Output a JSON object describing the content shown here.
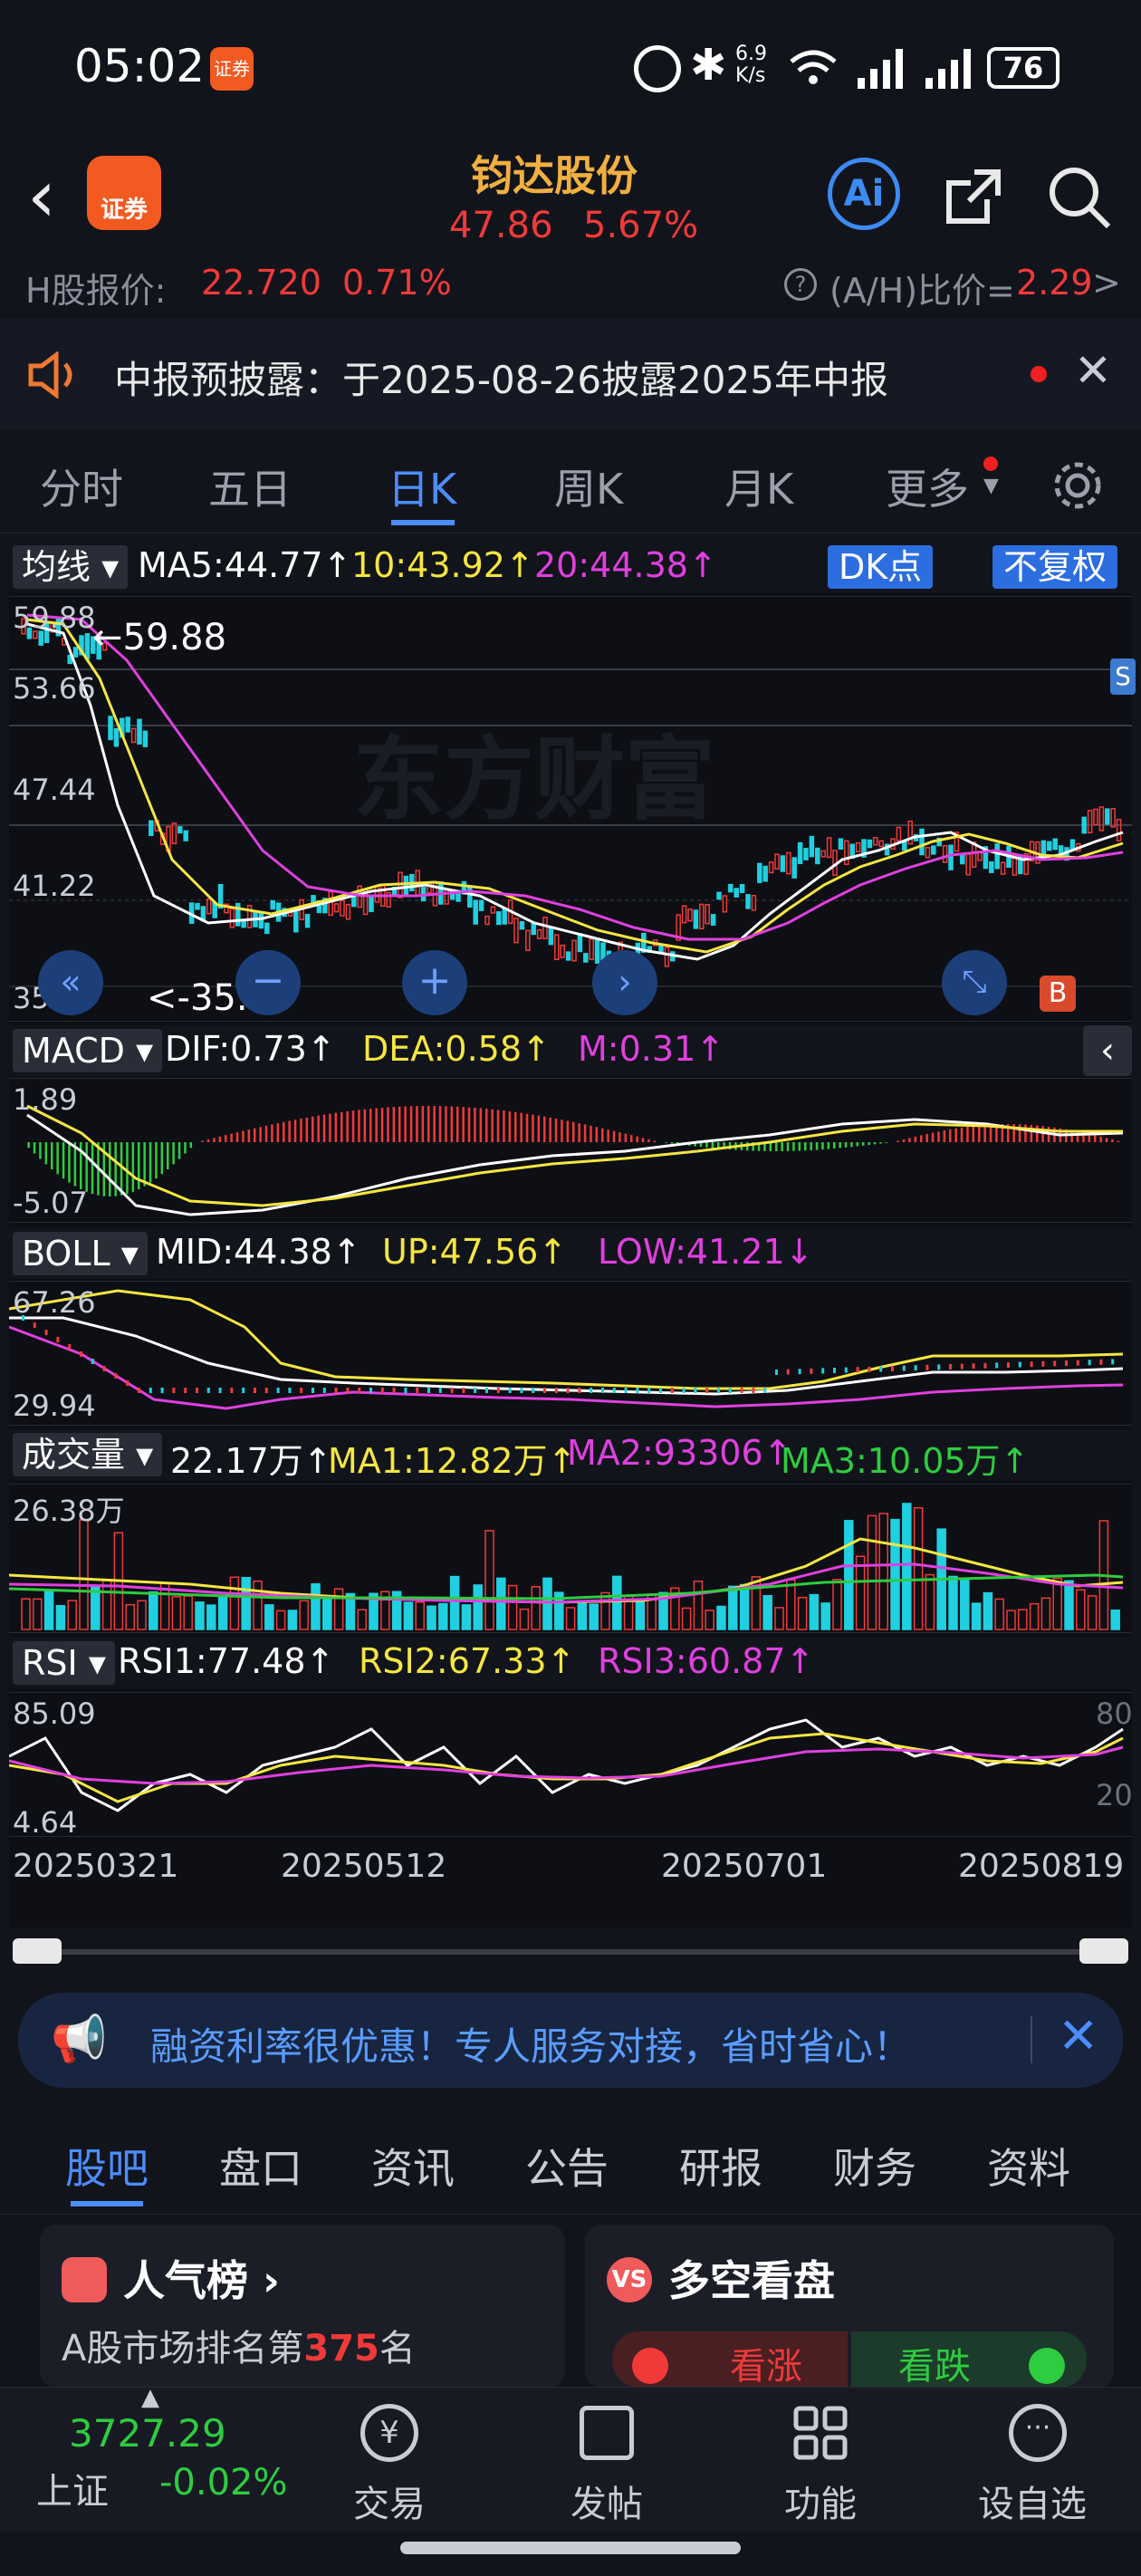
{
  "status_bar": {
    "time": "05:02",
    "app_badge": "证券",
    "net_speed_top": "6.9",
    "net_speed_unit": "K/s",
    "battery": "76"
  },
  "header": {
    "logo_text": "证券",
    "stock_name": "钧达股份",
    "price": "47.86",
    "change_pct": "5.67%",
    "ai_label": "Ai"
  },
  "h_share": {
    "label": "H股报价:",
    "price": "22.720",
    "change_pct": "0.71%",
    "ratio_label": "(A/H)比价=",
    "ratio_value": "2.29",
    "arrow": ">"
  },
  "notice": {
    "text": "中报预披露：于2025-08-26披露2025年中报"
  },
  "tabs": [
    "分时",
    "五日",
    "日K",
    "周K",
    "月K",
    "更多"
  ],
  "active_tab": 2,
  "kline": {
    "ma_selector": "均线",
    "ma5": "MA5:44.77",
    "ma10": "10:43.92",
    "ma20": "20:44.38",
    "dk_button": "DK点",
    "fq_button": "不复权",
    "y_labels": [
      "59.88",
      "53.66",
      "47.44",
      "41.22",
      "35.00"
    ],
    "high_label": "59.88",
    "low_label": "35.00",
    "watermark": "东方财富"
  },
  "macd": {
    "selector": "MACD",
    "dif": "DIF:0.73",
    "dea": "DEA:0.58",
    "m": "M:0.31",
    "y_top": "1.89",
    "y_bottom": "-5.07"
  },
  "boll": {
    "selector": "BOLL",
    "mid": "MID:44.38",
    "up": "UP:47.56",
    "low": "LOW:41.21",
    "y_top": "67.26",
    "y_bottom": "29.94"
  },
  "volume": {
    "selector": "成交量",
    "vol": "22.17万",
    "ma1": "MA1:12.82万",
    "ma2": "MA2:93306",
    "ma3": "MA3:10.05万",
    "y_top": "26.38万"
  },
  "rsi": {
    "selector": "RSI",
    "rsi1": "RSI1:77.48",
    "rsi2": "RSI2:67.33",
    "rsi3": "RSI3:60.87",
    "y_top": "85.09",
    "y_bottom": "4.64",
    "right_top": "80",
    "right_bottom": "20"
  },
  "dates": [
    "20250321",
    "20250512",
    "20250701",
    "20250819"
  ],
  "promo": {
    "text": "融资利率很优惠！专人服务对接，省时省心！"
  },
  "bottom_tabs": [
    "股吧",
    "盘口",
    "资讯",
    "公告",
    "研报",
    "财务",
    "资料"
  ],
  "cards": {
    "popularity_title": "人气榜",
    "popularity_text_pre": "A股市场排名第",
    "popularity_rank": "375",
    "popularity_text_post": "名",
    "duokong_title": "多空看盘",
    "bull": "看涨",
    "bear": "看跌"
  },
  "navbar": {
    "index_value": "3727.29",
    "index_name": "上证",
    "index_change": "-0.02%",
    "items": [
      "交易",
      "发帖",
      "功能",
      "设自选"
    ]
  }
}
